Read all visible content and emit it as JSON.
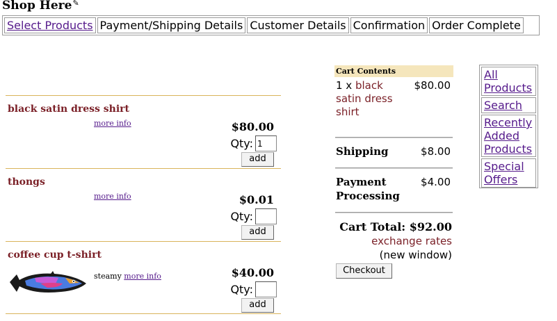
{
  "title": "Shop Here",
  "steps": [
    {
      "label": "Select Products",
      "link": true
    },
    {
      "label": "Payment/Shipping Details",
      "link": false
    },
    {
      "label": "Customer Details",
      "link": false
    },
    {
      "label": "Confirmation",
      "link": false
    },
    {
      "label": "Order Complete",
      "link": false
    }
  ],
  "products": [
    {
      "name": "black satin dress shirt",
      "more_info": "more info",
      "description": "",
      "price": "$80.00",
      "qty_label": "Qty:",
      "qty_value": "1",
      "add_label": "add"
    },
    {
      "name": "thongs",
      "more_info": "more info",
      "description": "",
      "price": "$0.01",
      "qty_label": "Qty:",
      "qty_value": "",
      "add_label": "add"
    },
    {
      "name": "coffee cup t-shirt",
      "more_info": "more info",
      "description": "steamy",
      "price": "$40.00",
      "qty_label": "Qty:",
      "qty_value": "",
      "add_label": "add",
      "image": "fish-image"
    }
  ],
  "cart": {
    "heading": "Cart Contents",
    "item_qty": "1 x",
    "item_name": "black satin dress shirt",
    "item_price": "$80.00",
    "shipping_label": "Shipping",
    "shipping_value": "$8.00",
    "payment_label": "Payment Processing",
    "payment_value": "$4.00",
    "total": "Cart Total: $92.00",
    "exchange_rates": "exchange rates",
    "new_window": "(new window)",
    "checkout_label": "Checkout"
  },
  "sidenav": [
    {
      "label": "All Products"
    },
    {
      "label": "Search"
    },
    {
      "label": "Recently Added Products"
    },
    {
      "label": "Special Offers"
    }
  ],
  "colors": {
    "product_name": "#7a1f26",
    "divider": "#d9b35a",
    "cart_header_bg": "#f5e6bc",
    "link": "#551a8b"
  }
}
